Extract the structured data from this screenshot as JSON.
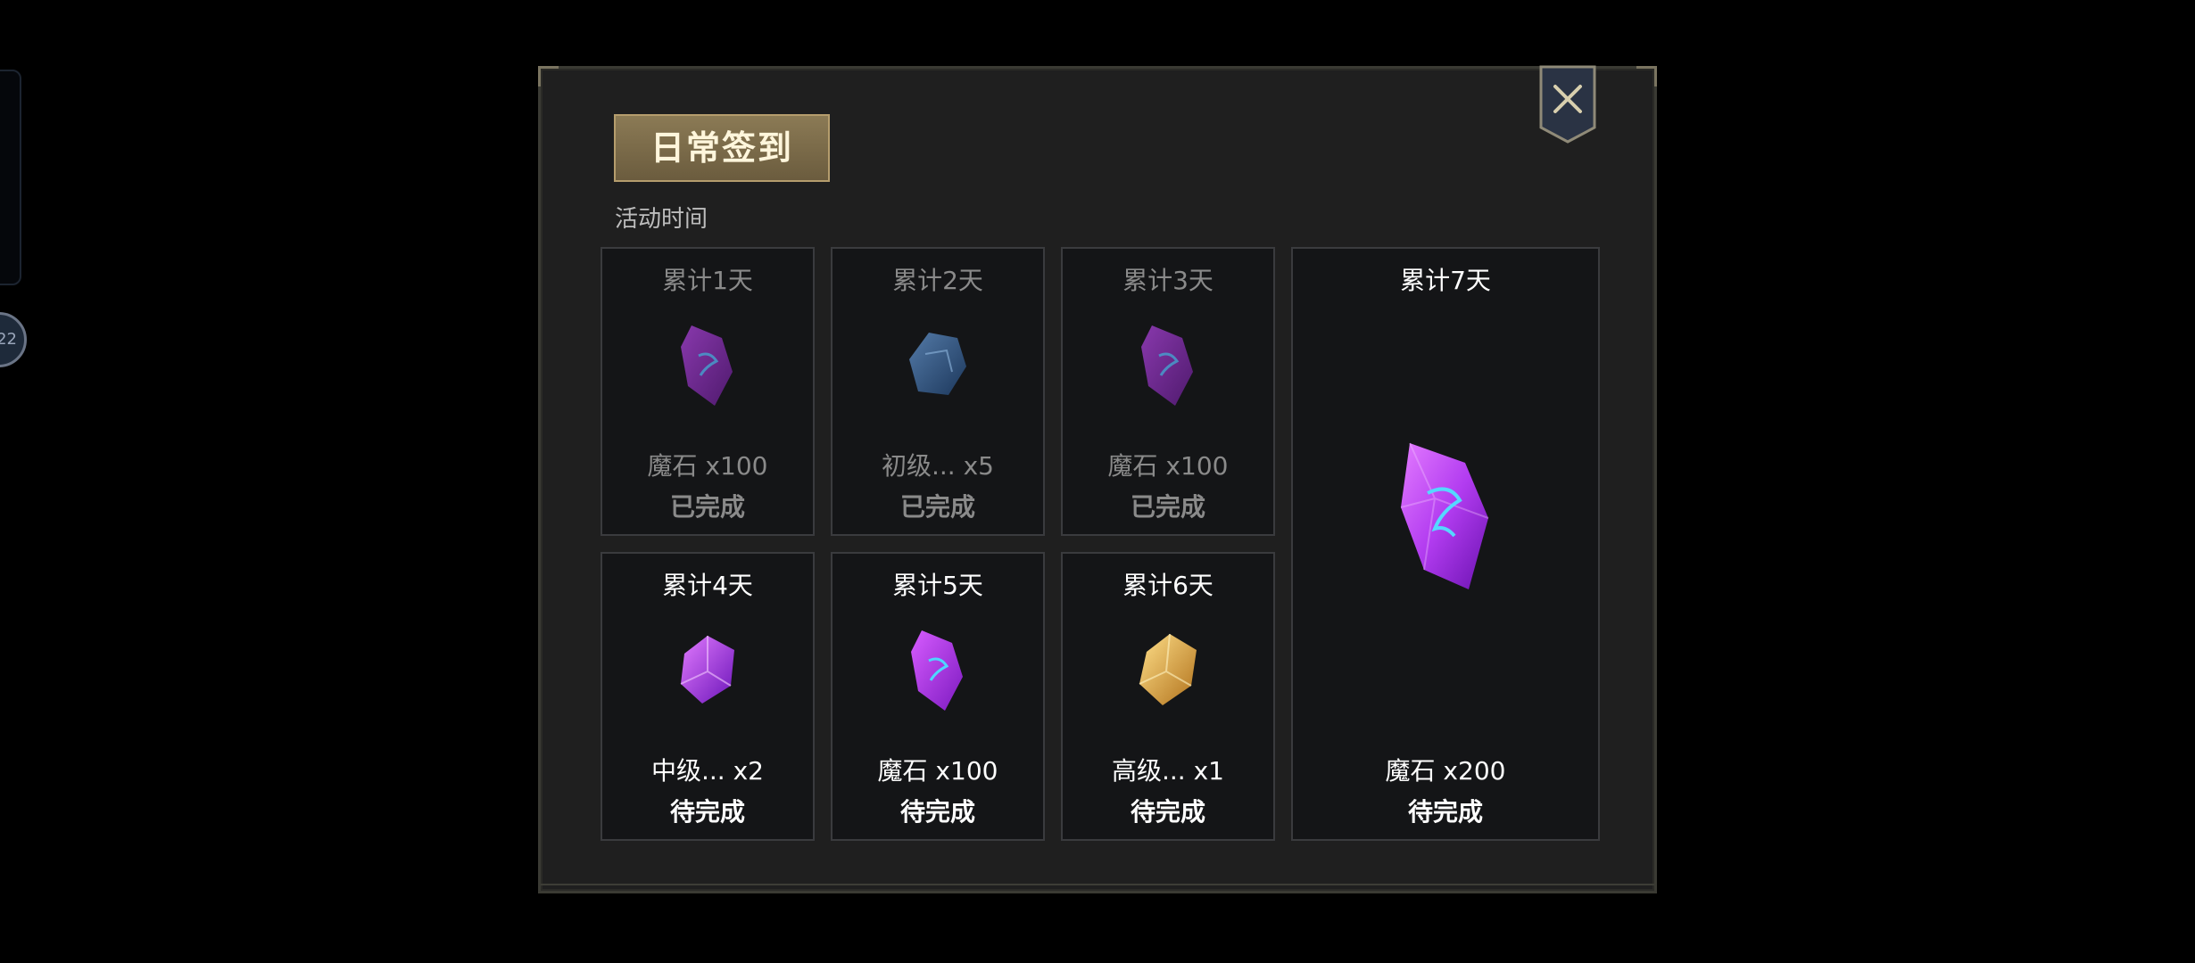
{
  "dialog": {
    "title": "日常签到",
    "subtitle": "活动时间"
  },
  "left_badge": "22",
  "cards": [
    {
      "day": "累计1天",
      "reward": "魔石 x100",
      "status": "已完成",
      "icon": "purple-magic-stone-icon",
      "done": true
    },
    {
      "day": "累计2天",
      "reward": "初级... x5",
      "status": "已完成",
      "icon": "blue-stone-icon",
      "done": true
    },
    {
      "day": "累计3天",
      "reward": "魔石 x100",
      "status": "已完成",
      "icon": "purple-magic-stone-icon",
      "done": true
    },
    {
      "day": "累计4天",
      "reward": "中级... x2",
      "status": "待完成",
      "icon": "violet-crystal-icon",
      "done": false
    },
    {
      "day": "累计5天",
      "reward": "魔石 x100",
      "status": "待完成",
      "icon": "purple-magic-stone-icon",
      "done": false
    },
    {
      "day": "累计6天",
      "reward": "高级... x1",
      "status": "待完成",
      "icon": "gold-crystal-icon",
      "done": false
    },
    {
      "day": "累计7天",
      "reward": "魔石 x200",
      "status": "待完成",
      "icon": "large-purple-magic-stone-icon",
      "done": false
    }
  ],
  "colors": {
    "gold_plate": "#8b7a55",
    "card_bg": "#141517",
    "done_text": "#8a8a8a",
    "pending_text": "#ffffff"
  }
}
